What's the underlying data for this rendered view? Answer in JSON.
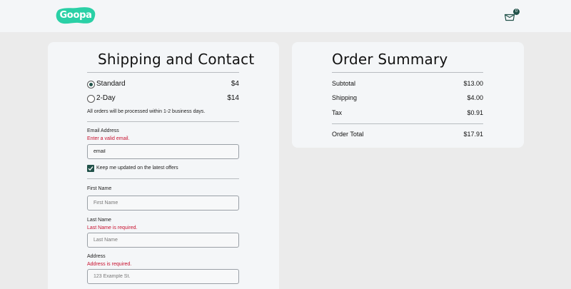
{
  "header": {
    "logo_text": "Goopa",
    "brand_color": "#2ad0a6",
    "cart_count": "0"
  },
  "shipping": {
    "title": "Shipping and Contact",
    "options": [
      {
        "label": "Standard",
        "price": "$4",
        "selected": true
      },
      {
        "label": "2-Day",
        "price": "$14",
        "selected": false
      }
    ],
    "note": "All orders will be processed within 1-2 business days."
  },
  "contact": {
    "email_label": "Email Address",
    "email_error": "Enter a valid email.",
    "email_value": "email",
    "newsletter_label": "Keep me updated on the latest offers",
    "newsletter_checked": true,
    "first_name_label": "First Name",
    "first_name_placeholder": "First Name",
    "last_name_label": "Last Name",
    "last_name_error": "Last Name is required.",
    "last_name_placeholder": "Last Name",
    "address_label": "Address",
    "address_error": "Address is required.",
    "address_placeholder": "123 Example St."
  },
  "summary": {
    "title": "Order Summary",
    "rows": [
      {
        "label": "Subtotal",
        "value": "$13.00"
      },
      {
        "label": "Shipping",
        "value": "$4.00"
      },
      {
        "label": "Tax",
        "value": "$0.91"
      }
    ],
    "total_label": "Order Total",
    "total_value": "$17.91"
  },
  "colors": {
    "accent": "#22524a",
    "error": "#c8102e"
  }
}
